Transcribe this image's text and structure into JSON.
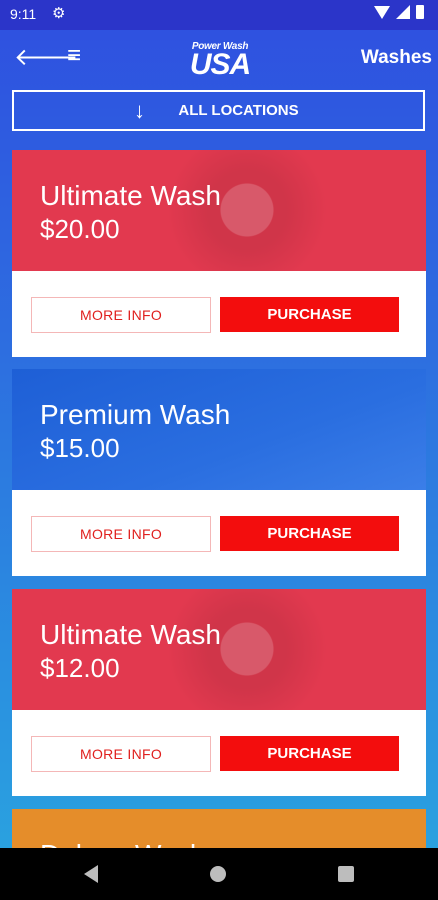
{
  "status_bar": {
    "time": "9:11"
  },
  "header": {
    "logo_top": "Power Wash",
    "logo_main": "USA",
    "title": "Washes"
  },
  "location_button": {
    "label": "ALL LOCATIONS"
  },
  "washes": [
    {
      "name": "Ultimate Wash",
      "price": "$20.00",
      "color": "#e2394f",
      "more_label": "MORE INFO",
      "buy_label": "PURCHASE"
    },
    {
      "name": "Premium Wash",
      "price": "$15.00",
      "color": "#2a6ee0",
      "more_label": "MORE INFO",
      "buy_label": "PURCHASE"
    },
    {
      "name": "Ultimate Wash",
      "price": "$12.00",
      "color": "#e2394f",
      "more_label": "MORE INFO",
      "buy_label": "PURCHASE"
    }
  ],
  "partial_card": {
    "name": "Deluxe Wash",
    "color": "#e58d2a"
  },
  "icons": {
    "back": "arrow-left-icon",
    "menu": "hamburger-icon",
    "settings": "gear-icon",
    "down": "arrow-down-icon"
  }
}
